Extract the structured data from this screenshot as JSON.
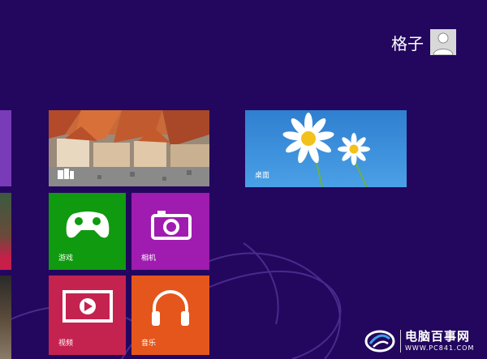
{
  "user": {
    "name": "格子",
    "avatar_icon": "user-silhouette-icon"
  },
  "tiles": {
    "photos": {
      "label": "",
      "icon": "photo-album-icon",
      "color": "#b85a2a"
    },
    "desktop": {
      "label": "桌面",
      "color": "#3a8fd6"
    },
    "games": {
      "label": "游戏",
      "icon": "xbox-controller-icon",
      "color": "#0f9a0f"
    },
    "camera": {
      "label": "相机",
      "icon": "camera-icon",
      "color": "#a01bb0"
    },
    "video": {
      "label": "视频",
      "icon": "video-play-icon",
      "color": "#c4234f"
    },
    "music": {
      "label": "音乐",
      "icon": "headphones-icon",
      "color": "#e5561c"
    }
  },
  "left_strip_color": "#7a3bb8",
  "watermark": {
    "title": "电脑百事网",
    "url": "WWW.PC841.COM"
  }
}
